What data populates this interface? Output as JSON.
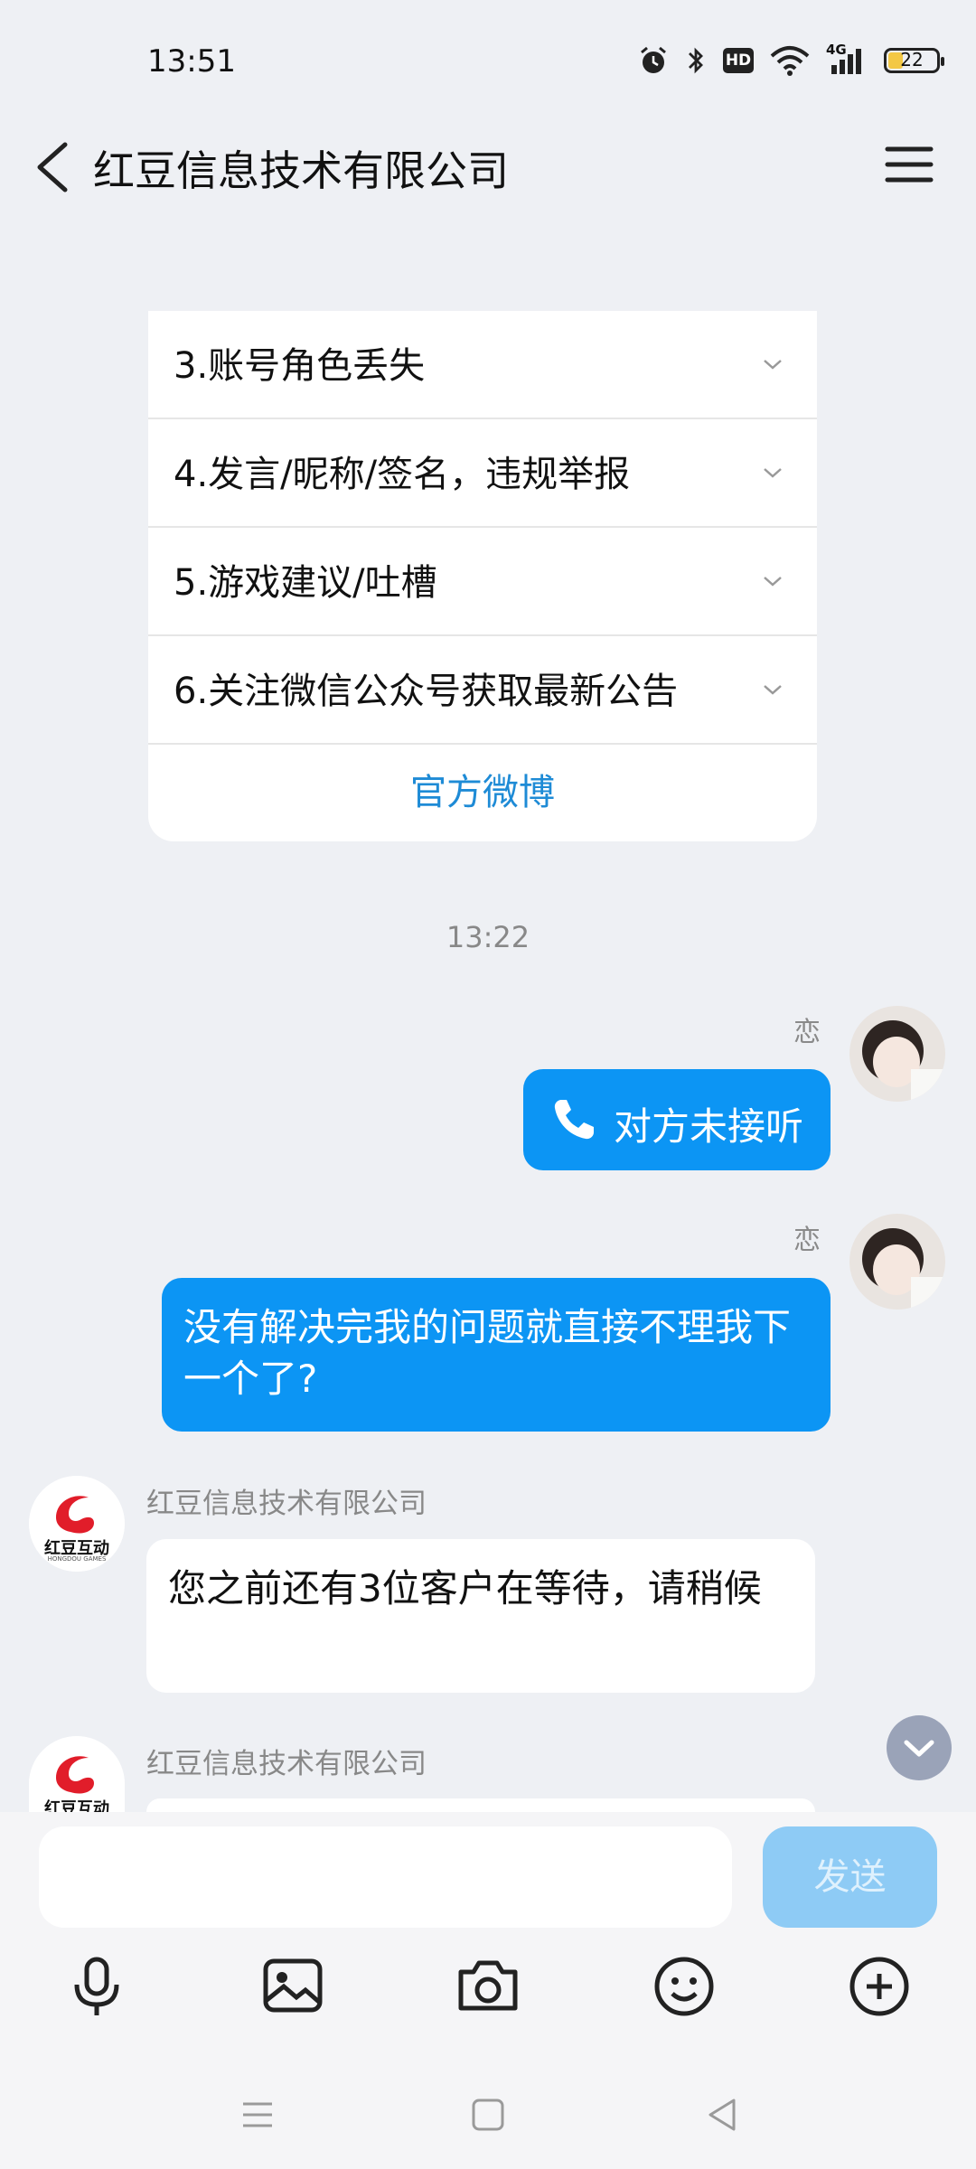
{
  "status_bar": {
    "time": "13:51",
    "battery": "22",
    "network": "4G",
    "hd": "HD"
  },
  "header": {
    "title": "红豆信息技术有限公司"
  },
  "faq": {
    "items": [
      {
        "label": "3.账号角色丢失"
      },
      {
        "label": "4.发言/昵称/签名，违规举报"
      },
      {
        "label": "5.游戏建议/吐槽"
      },
      {
        "label": "6.关注微信公众号获取最新公告"
      }
    ],
    "link": "官方微博"
  },
  "chat": {
    "timestamp": "13:22",
    "messages": [
      {
        "sender": "恋",
        "text": "对方未接听",
        "type": "call"
      },
      {
        "sender": "恋",
        "text": "没有解决完我的问题就直接不理我下一个了?"
      },
      {
        "sender": "红豆信息技术有限公司",
        "text": "您之前还有3位客户在等待，请稍候"
      },
      {
        "sender": "红豆信息技术有限公司",
        "text": ""
      }
    ],
    "company_logo_text": "红豆互动",
    "company_logo_sub": "HONGDOU GAMES"
  },
  "input": {
    "placeholder": "",
    "send_label": "发送"
  },
  "colors": {
    "accent": "#0c95f4",
    "link": "#1e8bd6",
    "send_disabled": "#8ecbf5"
  }
}
